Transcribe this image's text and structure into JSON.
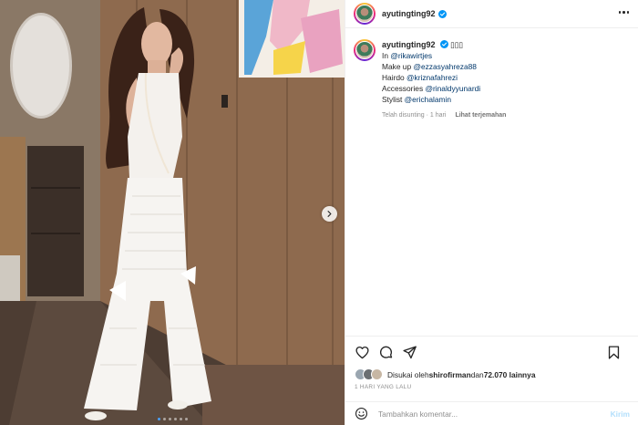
{
  "header": {
    "username": "ayutingting92",
    "more_icon": "more-horizontal-icon"
  },
  "caption": {
    "username": "ayutingting92",
    "emoji": "▯▯▯",
    "line1_prefix": "In ",
    "line1_mention": "@rikawirtjes",
    "line2_prefix": "Make up ",
    "line2_mention": "@ezzasyahreza88",
    "line3_prefix": "Hairdo ",
    "line3_mention": "@kriznafahrezi",
    "line4_prefix": "Accessories ",
    "line4_mention": "@rinaldyyunardi",
    "line5_prefix": "Stylist ",
    "line5_mention": "@erichalamin",
    "edited": "Telah disunting · 1 hari",
    "see_translation": "Lihat terjemahan"
  },
  "actions": {
    "like_icon": "heart-icon",
    "comment_icon": "comment-icon",
    "share_icon": "paper-plane-icon",
    "save_icon": "bookmark-icon"
  },
  "likes": {
    "prefix": "Disukai oleh ",
    "user": "shirofirman",
    "middle": " dan ",
    "count": "72.070 lainnya"
  },
  "time_ago": "1 HARI YANG LALU",
  "comment_box": {
    "placeholder": "Tambahkan komentar...",
    "post_label": "Kirim",
    "emoji_icon": "smiley-icon"
  },
  "carousel": {
    "next_icon": "chevron-right-icon",
    "total_slides": 6,
    "active_slide": 1
  },
  "colors": {
    "link": "#00376b",
    "muted": "#8e8e8e",
    "indicator_active": "#4a9ff5",
    "post_button": "#b2dffc"
  }
}
